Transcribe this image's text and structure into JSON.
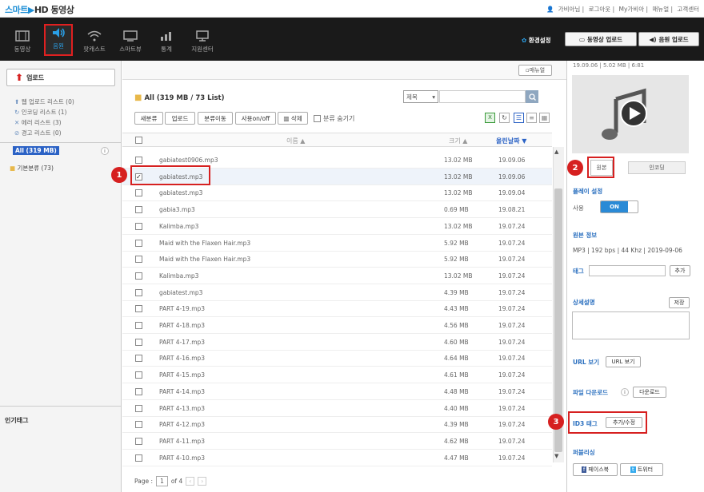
{
  "app": {
    "logo_part1": "스마트",
    "logo_part2": "HD",
    "logo_part3": "동영상"
  },
  "toplinks": [
    "가비아님",
    "로그아웃",
    "My가비아",
    "매뉴얼",
    "고객센터"
  ],
  "nav": [
    {
      "label": "동영상",
      "icon": "film-icon"
    },
    {
      "label": "음원",
      "icon": "speaker-icon"
    },
    {
      "label": "팟캐스트",
      "icon": "wifi-icon"
    },
    {
      "label": "스마트뷰",
      "icon": "monitor-icon"
    },
    {
      "label": "통계",
      "icon": "chart-icon"
    },
    {
      "label": "지원센터",
      "icon": "support-icon"
    }
  ],
  "header": {
    "env": "환경설정",
    "video_upload": "동영상 업로드",
    "audio_upload": "음원 업로드"
  },
  "left": {
    "upload": "업로드",
    "stats": [
      "웹 업로드 리스트 (0)",
      "인코딩 리스트 (1)",
      "에러 리스트 (3)",
      "경고 리스트 (0)"
    ],
    "all": "All (319 MB)",
    "info": "i",
    "folder": "기본분류 (73)",
    "popular": "인기태그"
  },
  "main": {
    "manual": "매뉴얼",
    "crumb": "All (319 MB / 73 List)",
    "select": "제목",
    "toolbar": [
      "새분류",
      "업로드",
      "분류이동",
      "사용on/off",
      "삭제"
    ],
    "hide": "분류 숨기기",
    "col_name": "이름 ▲",
    "col_size": "크기 ▲",
    "col_date": "올린날짜 ▼",
    "rows": [
      {
        "name": "gabiatest0906.mp3",
        "size": "13.02 MB",
        "date": "19.09.06"
      },
      {
        "name": "gabiatest.mp3",
        "size": "13.02 MB",
        "date": "19.09.06"
      },
      {
        "name": "gabiatest.mp3",
        "size": "13.02 MB",
        "date": "19.09.04"
      },
      {
        "name": "gabia3.mp3",
        "size": "0.69 MB",
        "date": "19.08.21"
      },
      {
        "name": "Kalimba.mp3",
        "size": "13.02 MB",
        "date": "19.07.24"
      },
      {
        "name": "Maid with the Flaxen Hair.mp3",
        "size": "5.92 MB",
        "date": "19.07.24"
      },
      {
        "name": "Maid with the Flaxen Hair.mp3",
        "size": "5.92 MB",
        "date": "19.07.24"
      },
      {
        "name": "Kalimba.mp3",
        "size": "13.02 MB",
        "date": "19.07.24"
      },
      {
        "name": "gabiatest.mp3",
        "size": "4.39 MB",
        "date": "19.07.24"
      },
      {
        "name": "PART 4-19.mp3",
        "size": "4.43 MB",
        "date": "19.07.24"
      },
      {
        "name": "PART 4-18.mp3",
        "size": "4.56 MB",
        "date": "19.07.24"
      },
      {
        "name": "PART 4-17.mp3",
        "size": "4.60 MB",
        "date": "19.07.24"
      },
      {
        "name": "PART 4-16.mp3",
        "size": "4.64 MB",
        "date": "19.07.24"
      },
      {
        "name": "PART 4-15.mp3",
        "size": "4.61 MB",
        "date": "19.07.24"
      },
      {
        "name": "PART 4-14.mp3",
        "size": "4.48 MB",
        "date": "19.07.24"
      },
      {
        "name": "PART 4-13.mp3",
        "size": "4.40 MB",
        "date": "19.07.24"
      },
      {
        "name": "PART 4-12.mp3",
        "size": "4.39 MB",
        "date": "19.07.24"
      },
      {
        "name": "PART 4-11.mp3",
        "size": "4.62 MB",
        "date": "19.07.24"
      },
      {
        "name": "PART 4-10.mp3",
        "size": "4.47 MB",
        "date": "19.07.24"
      }
    ],
    "page_label": "Page :",
    "page": "1",
    "page_total": "of 4"
  },
  "right": {
    "meta": "19.09.06 | 5.02 MB | 6:81",
    "tab_original": "원본",
    "tab_encoding": "인코딩",
    "play_setting": "플레이 설정",
    "use": "사용",
    "on": "ON",
    "orig_info": "원본 정보",
    "orig_detail": "MP3 | 192 bps | 44 Khz | 2019-09-06",
    "tag": "태그",
    "tag_add": "추가",
    "desc": "상세설명",
    "save": "저장",
    "url": "URL 보기",
    "url_btn": "URL 보기",
    "download": "파일 다운로드",
    "download_btn": "다운로드",
    "id3": "ID3 태그",
    "id3_btn": "추가/수정",
    "publish": "퍼블리싱",
    "facebook": "페이스북",
    "twitter": "트위터"
  },
  "badges": [
    "1",
    "2",
    "3"
  ],
  "colors": {
    "accent": "#1e8fd6",
    "highlight": "#d62020",
    "selected_tab": "#2b62c5"
  }
}
